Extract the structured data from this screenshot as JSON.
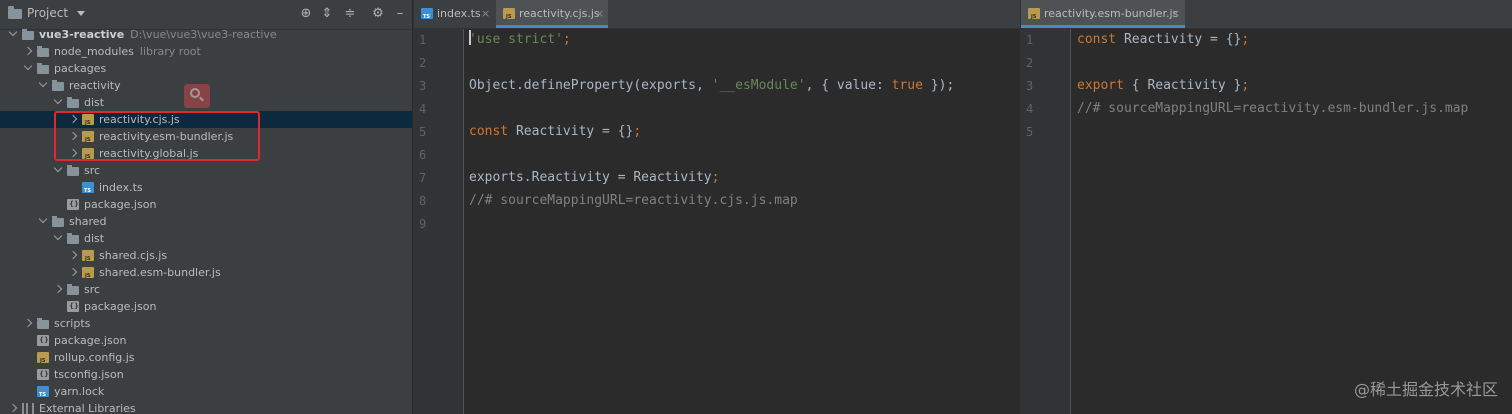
{
  "project_panel": {
    "title": "Project",
    "toolbar_icons": [
      "target-icon",
      "expand-all-icon",
      "collapse-all-icon",
      "gear-icon",
      "minimize-icon"
    ],
    "tree": [
      {
        "label": "vue3-reactive",
        "hint": "D:\\vue\\vue3\\vue3-reactive",
        "bold": true,
        "icon": "folder",
        "arrow": "down",
        "depth": 0
      },
      {
        "label": "node_modules",
        "hint": "library root",
        "icon": "folder",
        "arrow": "right",
        "depth": 1
      },
      {
        "label": "packages",
        "icon": "folder",
        "arrow": "down",
        "depth": 1
      },
      {
        "label": "reactivity",
        "icon": "folder",
        "arrow": "down",
        "depth": 2
      },
      {
        "label": "dist",
        "icon": "folder",
        "arrow": "down",
        "depth": 3
      },
      {
        "label": "reactivity.cjs.js",
        "icon": "js",
        "arrow": "right",
        "depth": 4,
        "selected": true
      },
      {
        "label": "reactivity.esm-bundler.js",
        "icon": "js",
        "arrow": "right",
        "depth": 4
      },
      {
        "label": "reactivity.global.js",
        "icon": "js",
        "arrow": "right",
        "depth": 4
      },
      {
        "label": "src",
        "icon": "folder",
        "arrow": "down",
        "depth": 3
      },
      {
        "label": "index.ts",
        "icon": "ts",
        "arrow": "none",
        "depth": 4
      },
      {
        "label": "package.json",
        "icon": "json",
        "arrow": "none",
        "depth": 3
      },
      {
        "label": "shared",
        "icon": "folder",
        "arrow": "down",
        "depth": 2
      },
      {
        "label": "dist",
        "icon": "folder",
        "arrow": "down",
        "depth": 3
      },
      {
        "label": "shared.cjs.js",
        "icon": "js",
        "arrow": "right",
        "depth": 4
      },
      {
        "label": "shared.esm-bundler.js",
        "icon": "js",
        "arrow": "right",
        "depth": 4
      },
      {
        "label": "src",
        "icon": "folder",
        "arrow": "right",
        "depth": 3
      },
      {
        "label": "package.json",
        "icon": "json",
        "arrow": "none",
        "depth": 3
      },
      {
        "label": "scripts",
        "icon": "folder",
        "arrow": "right",
        "depth": 1
      },
      {
        "label": "package.json",
        "icon": "json",
        "arrow": "none",
        "depth": 1
      },
      {
        "label": "rollup.config.js",
        "icon": "js",
        "arrow": "none",
        "depth": 1
      },
      {
        "label": "tsconfig.json",
        "icon": "json",
        "arrow": "none",
        "depth": 1
      },
      {
        "label": "yarn.lock",
        "icon": "ts",
        "arrow": "none",
        "depth": 1
      },
      {
        "label": "External Libraries",
        "icon": "lib",
        "arrow": "right",
        "depth": 0
      }
    ]
  },
  "editor_left": {
    "tabs": [
      {
        "label": "index.ts",
        "icon": "ts",
        "active": false
      },
      {
        "label": "reactivity.cjs.js",
        "icon": "js",
        "active": true
      }
    ],
    "line_numbers": [
      "1",
      "2",
      "3",
      "4",
      "5",
      "6",
      "7",
      "8",
      "9"
    ],
    "code": [
      [
        {
          "t": "'use strict'",
          "c": "str"
        },
        {
          "t": ";",
          "c": "kw"
        }
      ],
      [],
      [
        {
          "t": "Object.defineProperty(exports, ",
          "c": "pl"
        },
        {
          "t": "'__esModule'",
          "c": "str"
        },
        {
          "t": ", { value: ",
          "c": "pl"
        },
        {
          "t": "true",
          "c": "kw"
        },
        {
          "t": " });",
          "c": "pl"
        }
      ],
      [],
      [
        {
          "t": "const ",
          "c": "kw"
        },
        {
          "t": "Reactivity = {}",
          "c": "pl"
        },
        {
          "t": ";",
          "c": "kw"
        }
      ],
      [],
      [
        {
          "t": "exports.Reactivity = Reactivity",
          "c": "pl"
        },
        {
          "t": ";",
          "c": "kw"
        }
      ],
      [
        {
          "t": "//# sourceMappingURL=reactivity.cjs.js.map",
          "c": "cmt"
        }
      ],
      []
    ]
  },
  "editor_right": {
    "tabs": [
      {
        "label": "reactivity.esm-bundler.js",
        "icon": "js",
        "active": true
      }
    ],
    "line_numbers": [
      "1",
      "2",
      "3",
      "4",
      "5"
    ],
    "code": [
      [
        {
          "t": "const ",
          "c": "kw"
        },
        {
          "t": "Reactivity = {}",
          "c": "pl"
        },
        {
          "t": ";",
          "c": "kw"
        }
      ],
      [],
      [
        {
          "t": "export ",
          "c": "kw"
        },
        {
          "t": "{ Reactivity }",
          "c": "pl"
        },
        {
          "t": ";",
          "c": "kw"
        }
      ],
      [
        {
          "t": "//# sourceMappingURL=reactivity.esm-bundler.js.map",
          "c": "cmt"
        }
      ],
      []
    ]
  },
  "watermark": "@稀土掘金技术社区",
  "colors": {
    "keyword": "#cc7832",
    "string": "#6a8759",
    "comment": "#808080",
    "plain": "#a9b7c6",
    "highlight_box": "#e0282e",
    "selection": "#0d293e",
    "tab_underline": "#4a88c7"
  }
}
